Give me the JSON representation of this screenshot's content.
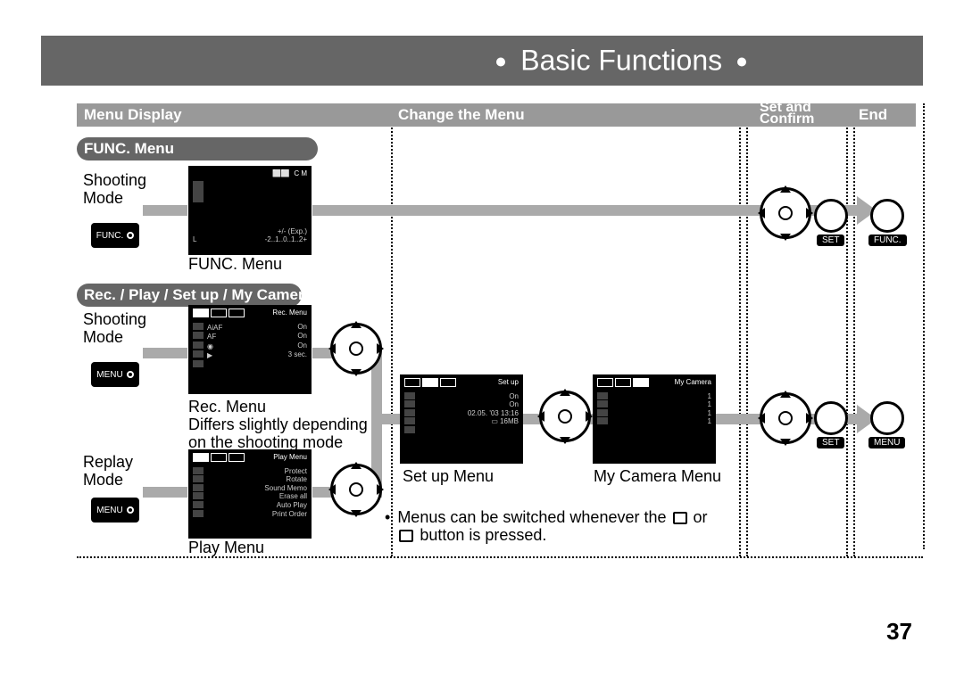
{
  "header": {
    "title": "Basic Functions"
  },
  "columns": {
    "menu_display": "Menu Display",
    "change": "Change the Menu",
    "set_confirm": "Set and\nConfirm",
    "end": "End"
  },
  "sections": {
    "func": "FUNC. Menu",
    "rec": "Rec. / Play / Set up / My Camera Menu"
  },
  "modes": {
    "shooting": "Shooting\nMode",
    "replay": "Replay\nMode"
  },
  "buttons": {
    "func": "FUNC.",
    "menu": "MENU",
    "set": "SET"
  },
  "captions": {
    "func_menu": "FUNC. Menu",
    "rec_menu": "Rec. Menu\nDiffers slightly depending\non the shooting mode",
    "play_menu": "Play Menu",
    "setup_menu": "Set up Menu",
    "mycamera_menu": "My Camera Menu"
  },
  "note": {
    "bullet": "•",
    "text_a": "Menus can be switched whenever the",
    "text_b": "or",
    "text_c": "button is pressed."
  },
  "lcd": {
    "rec_menu": {
      "title": "Rec. Menu",
      "af": "On",
      "redeye": "On",
      "review": "3 sec."
    },
    "play_menu": {
      "title": "Play Menu",
      "items": [
        "Protect",
        "Rotate",
        "Sound Memo",
        "Erase all",
        "Auto Play",
        "Print Order"
      ]
    },
    "setup": {
      "title": "Set up",
      "r1": "On",
      "r2": "On",
      "date": "02.05. '03 13:16",
      "card": "16MB"
    },
    "mycamera": {
      "title": "My Camera",
      "v1": "1",
      "v2": "1",
      "v3": "1",
      "v4": "1"
    },
    "func": {
      "exp": "+/- (Exp.)",
      "scale": "-2..1..0..1..2+"
    }
  },
  "page_number": "37"
}
